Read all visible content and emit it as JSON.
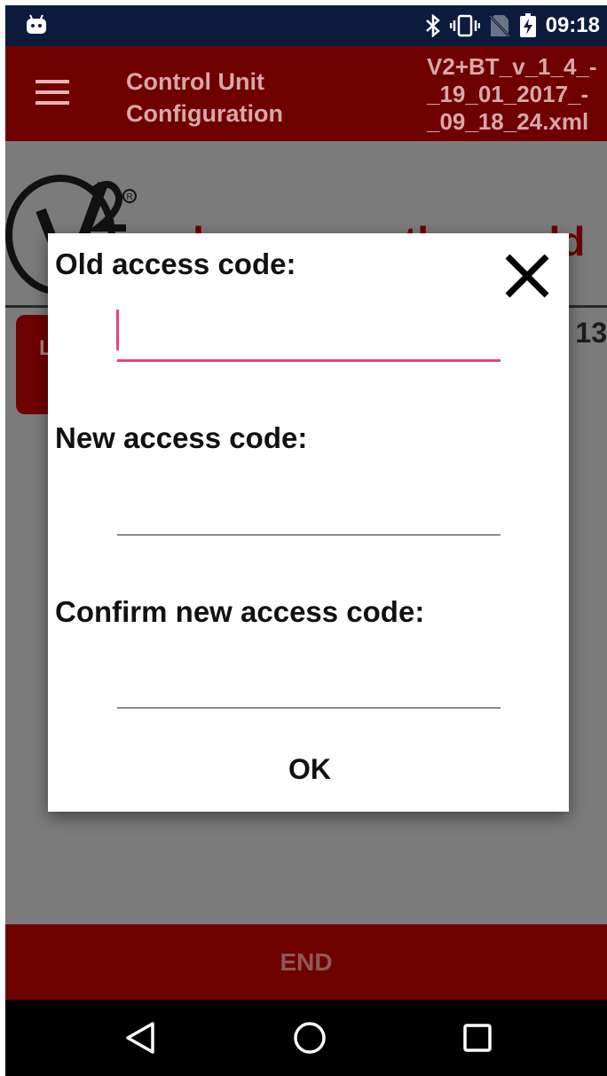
{
  "status_bar": {
    "time": "09:18",
    "icons": [
      "android-debug-icon",
      "bluetooth-icon",
      "vibrate-icon",
      "no-sim-icon",
      "battery-charging-icon"
    ]
  },
  "app_bar": {
    "title": "Control Unit\nConfiguration",
    "file_name": "V2+BT_v_1_4_-\n_19_01_2017_-\n_09_18_24.xml"
  },
  "background": {
    "slogan": "value moves the world",
    "side_button_label": "L",
    "right_value": "13"
  },
  "dialog": {
    "old_label": "Old access code:",
    "new_label": "New access code:",
    "confirm_label": "Confirm new access code:",
    "old_value": "",
    "new_value": "",
    "confirm_value": "",
    "ok_label": "OK"
  },
  "footer": {
    "end_label": "END"
  },
  "colors": {
    "brand_red": "#6e0000",
    "accent_pink": "#e5457c",
    "status_bar": "#0c1a3c"
  }
}
